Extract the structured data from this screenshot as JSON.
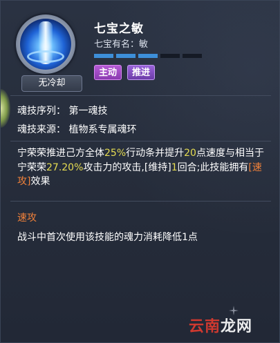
{
  "skill": {
    "name": "七宝之敏",
    "owner_label": "七宝有名：敏",
    "level_filled": 3,
    "level_total": 5,
    "cooldown_label": "无冷却",
    "tags": [
      "主动",
      "推进"
    ]
  },
  "info": {
    "sequence": "魂技序列：  第一魂技",
    "source": "魂技来源：  植物系专属魂环"
  },
  "description": {
    "p1": "宁荣荣推进己方全体",
    "v1": "25%",
    "p2": "行动条并提升",
    "v2": "20",
    "p3": "点速度与相当于宁荣荣",
    "v3": "27.20%",
    "p4": "攻击力的攻击,[维持]",
    "v4": "1",
    "p5": "回合;此技能拥有",
    "v5": "[速攻]",
    "p6": "效果"
  },
  "extra": {
    "title": "速攻",
    "text": "战斗中首次使用该技能的魂力消耗降低1点"
  },
  "watermark": {
    "red": "云南",
    "white": "龙网"
  },
  "colors": {
    "highlight_yellow": "#e7dd52",
    "highlight_orange": "#f0813a",
    "level_on": "#3d8fd9",
    "tag_active": "#b65bd6",
    "tag_push": "#9a63d9"
  }
}
